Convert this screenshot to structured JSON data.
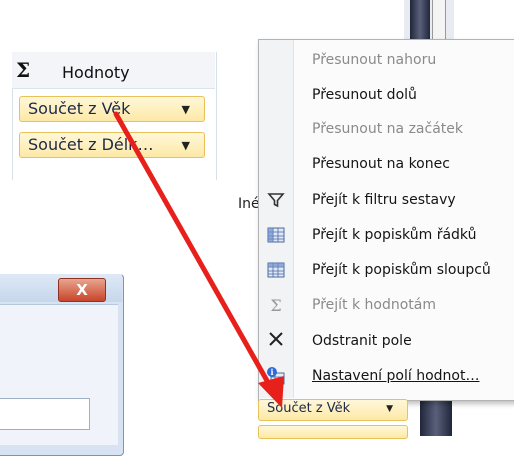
{
  "values_panel": {
    "sigma": "Σ",
    "title": "Hodnoty",
    "fields": [
      {
        "label": "Součet z Věk"
      },
      {
        "label": "Součet z Délk…"
      }
    ],
    "dropdown_glyph": "▼"
  },
  "dialog": {
    "close_glyph": "X"
  },
  "side_label": "Iné",
  "context_menu": {
    "items": [
      {
        "label": "Přesunout nahoru",
        "enabled": false,
        "icon": ""
      },
      {
        "label": "Přesunout dolů",
        "enabled": true,
        "icon": ""
      },
      {
        "label": "Přesunout na začátek",
        "enabled": false,
        "icon": ""
      },
      {
        "label": "Přesunout na konec",
        "enabled": true,
        "icon": ""
      },
      {
        "label": "Přejít k filtru sestavy",
        "enabled": true,
        "icon": "filter-icon"
      },
      {
        "label": "Přejít k popiskům řádků",
        "enabled": true,
        "icon": "row-labels-icon"
      },
      {
        "label": "Přejít k popiskům sloupců",
        "enabled": true,
        "icon": "column-labels-icon"
      },
      {
        "label": "Přejít k hodnotám",
        "enabled": false,
        "icon": "sigma-icon"
      },
      {
        "label": "Odstranit pole",
        "enabled": true,
        "icon": "remove-icon"
      },
      {
        "label": "Nastavení polí hodnot…",
        "enabled": true,
        "icon": "field-settings-icon"
      }
    ]
  },
  "bottom_chip": {
    "label": "Součet z Věk"
  },
  "colors": {
    "chip_fill": "#fde9a6",
    "chip_border": "#e8c15a",
    "arrow": "#e8201c"
  }
}
